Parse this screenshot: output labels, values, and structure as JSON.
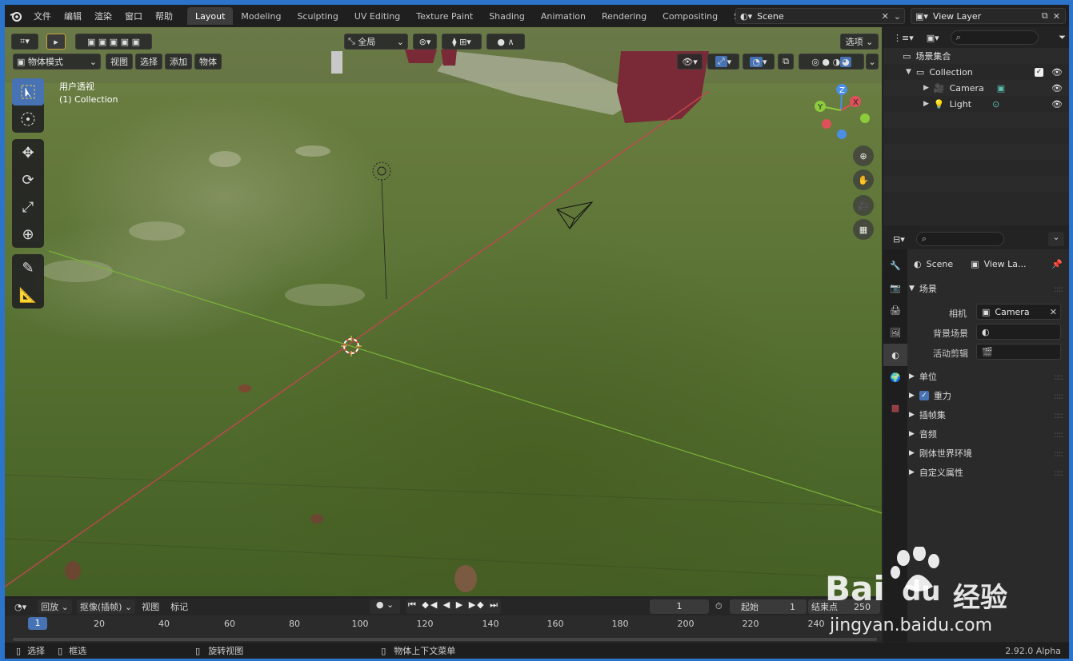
{
  "topbar": {
    "menu": [
      "文件",
      "编辑",
      "渲染",
      "窗口",
      "帮助"
    ],
    "workspaces": [
      "Layout",
      "Modeling",
      "Sculpting",
      "UV Editing",
      "Texture Paint",
      "Shading",
      "Animation",
      "Rendering",
      "Compositing",
      "Scripting"
    ],
    "active_workspace": "Layout",
    "scene": "Scene",
    "view_layer": "View Layer"
  },
  "viewport": {
    "mode": "物体模式",
    "menus": [
      "视图",
      "选择",
      "添加",
      "物体"
    ],
    "orientation": "全局",
    "options_label": "选项",
    "overlay_title": "用户透视",
    "overlay_collection": "(1) Collection",
    "gizmo_labels": {
      "z": "Z",
      "y": "Y",
      "x": "X"
    },
    "colors": {
      "x_axis": "#e0505a",
      "y_axis": "#8ccc3c",
      "z_axis": "#4a8ee6",
      "active_tool": "#4772b3"
    }
  },
  "outliner": {
    "title": "场景集合",
    "collection": "Collection",
    "items": [
      "Camera",
      "Light"
    ]
  },
  "properties": {
    "scene_tab": "Scene",
    "viewlayer_tab": "View La...",
    "section_scene": "场景",
    "camera_label": "相机",
    "camera_value": "Camera",
    "bg_scene_label": "背景场景",
    "active_clip_label": "活动剪辑",
    "sections": [
      "单位",
      "重力",
      "插帧集",
      "音频",
      "刚体世界环境",
      "自定义属性"
    ],
    "gravity_checked": true
  },
  "timeline": {
    "menus": [
      "回放",
      "抠像(插帧)",
      "视图",
      "标记"
    ],
    "current_frame": "1",
    "start_label": "起始",
    "start_value": "1",
    "end_label": "结束点",
    "end_value": "250",
    "ruler": [
      "1",
      "20",
      "40",
      "60",
      "80",
      "100",
      "120",
      "140",
      "160",
      "180",
      "200",
      "220",
      "240"
    ]
  },
  "statusbar": {
    "select": "选择",
    "box_select": "框选",
    "rotate": "旋转视图",
    "context_menu": "物体上下文菜单",
    "version": "2.92.0 Alpha"
  },
  "watermark": {
    "brand": "Bai",
    "brand2": "du",
    "cn": "经验",
    "url": "jingyan.baidu.com"
  }
}
